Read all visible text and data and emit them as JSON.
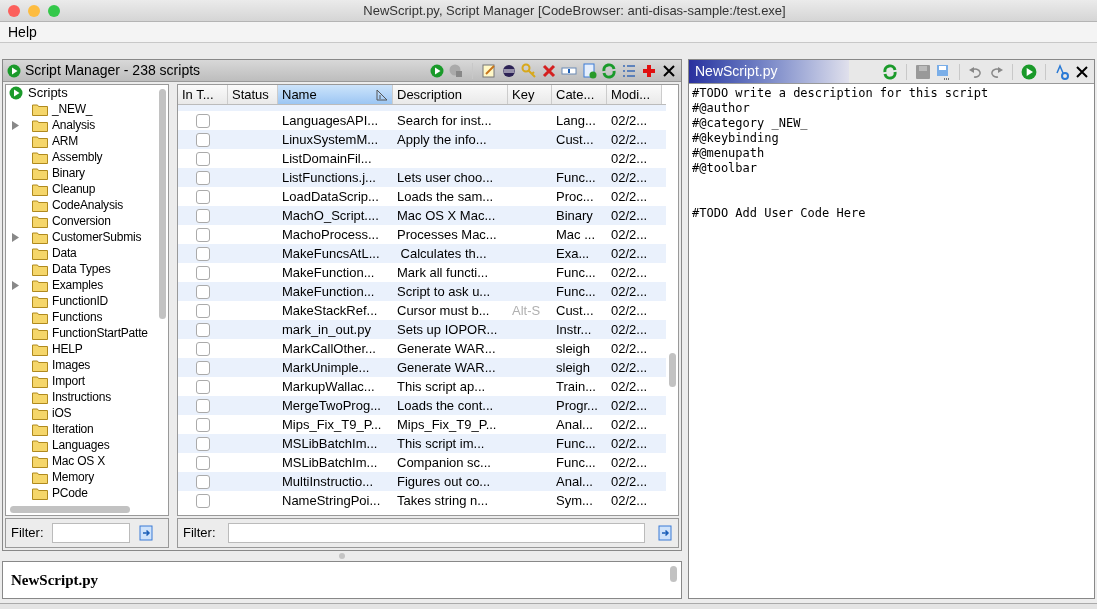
{
  "window": {
    "title": "NewScript.py, Script Manager [CodeBrowser: anti-disas-sample:/test.exe]"
  },
  "menu": [
    "Help"
  ],
  "script_manager": {
    "title": "Script Manager - 238 scripts",
    "tree": {
      "label": "Scripts",
      "children": [
        {
          "label": "_NEW_",
          "expandable": false
        },
        {
          "label": "Analysis",
          "expandable": true
        },
        {
          "label": "ARM",
          "expandable": false
        },
        {
          "label": "Assembly",
          "expandable": false
        },
        {
          "label": "Binary",
          "expandable": false
        },
        {
          "label": "Cleanup",
          "expandable": false
        },
        {
          "label": "CodeAnalysis",
          "expandable": false
        },
        {
          "label": "Conversion",
          "expandable": false
        },
        {
          "label": "CustomerSubmis",
          "expandable": true
        },
        {
          "label": "Data",
          "expandable": false
        },
        {
          "label": "Data Types",
          "expandable": false
        },
        {
          "label": "Examples",
          "expandable": true
        },
        {
          "label": "FunctionID",
          "expandable": false
        },
        {
          "label": "Functions",
          "expandable": false
        },
        {
          "label": "FunctionStartPatte",
          "expandable": false
        },
        {
          "label": "HELP",
          "expandable": false
        },
        {
          "label": "Images",
          "expandable": false
        },
        {
          "label": "Import",
          "expandable": false
        },
        {
          "label": "Instructions",
          "expandable": false
        },
        {
          "label": "iOS",
          "expandable": false
        },
        {
          "label": "Iteration",
          "expandable": false
        },
        {
          "label": "Languages",
          "expandable": false
        },
        {
          "label": "Mac OS X",
          "expandable": false
        },
        {
          "label": "Memory",
          "expandable": false
        },
        {
          "label": "PCode",
          "expandable": false
        }
      ]
    },
    "table": {
      "columns": [
        {
          "label": "In T...",
          "selected": false
        },
        {
          "label": "Status",
          "selected": false
        },
        {
          "label": "Name",
          "selected": true
        },
        {
          "label": "Description",
          "selected": false
        },
        {
          "label": "Key",
          "selected": false
        },
        {
          "label": "Cate...",
          "selected": false
        },
        {
          "label": "Modi...",
          "selected": false
        }
      ],
      "rows": [
        {
          "in_tool": false,
          "name": "LanguagesAPI...",
          "description": "Search for inst...",
          "key": "",
          "category": "Lang...",
          "modified": "02/2..."
        },
        {
          "in_tool": false,
          "name": "LinuxSystemM...",
          "description": "Apply the info...",
          "key": "",
          "category": "Cust...",
          "modified": "02/2..."
        },
        {
          "in_tool": false,
          "name": "ListDomainFil...",
          "description": "",
          "key": "",
          "category": "",
          "modified": "02/2..."
        },
        {
          "in_tool": false,
          "name": "ListFunctions.j...",
          "description": "Lets user choo...",
          "key": "",
          "category": "Func...",
          "modified": "02/2..."
        },
        {
          "in_tool": false,
          "name": "LoadDataScrip...",
          "description": "Loads the sam...",
          "key": "",
          "category": "Proc...",
          "modified": "02/2..."
        },
        {
          "in_tool": false,
          "name": "MachO_Script....",
          "description": "Mac OS X Mac...",
          "key": "",
          "category": "Binary",
          "modified": "02/2..."
        },
        {
          "in_tool": false,
          "name": "MachoProcess...",
          "description": "Processes Mac...",
          "key": "",
          "category": "Mac ...",
          "modified": "02/2..."
        },
        {
          "in_tool": false,
          "name": "MakeFuncsAtL...",
          "description": " Calculates th...",
          "key": "",
          "category": "Exa...",
          "modified": "02/2..."
        },
        {
          "in_tool": false,
          "name": "MakeFunction...",
          "description": "Mark all functi...",
          "key": "",
          "category": "Func...",
          "modified": "02/2..."
        },
        {
          "in_tool": false,
          "name": "MakeFunction...",
          "description": "Script to ask u...",
          "key": "",
          "category": "Func...",
          "modified": "02/2..."
        },
        {
          "in_tool": false,
          "name": "MakeStackRef...",
          "description": "Cursor must b...",
          "key": "Alt-S",
          "category": "Cust...",
          "modified": "02/2..."
        },
        {
          "in_tool": false,
          "name": "mark_in_out.py",
          "description": "Sets up IOPOR...",
          "key": "",
          "category": "Instr...",
          "modified": "02/2..."
        },
        {
          "in_tool": false,
          "name": "MarkCallOther...",
          "description": "Generate WAR...",
          "key": "",
          "category": "sleigh",
          "modified": "02/2..."
        },
        {
          "in_tool": false,
          "name": "MarkUnimple...",
          "description": "Generate WAR...",
          "key": "",
          "category": "sleigh",
          "modified": "02/2..."
        },
        {
          "in_tool": false,
          "name": "MarkupWallac...",
          "description": "This script ap...",
          "key": "",
          "category": "Train...",
          "modified": "02/2..."
        },
        {
          "in_tool": false,
          "name": "MergeTwoProg...",
          "description": "Loads the cont...",
          "key": "",
          "category": "Progr...",
          "modified": "02/2..."
        },
        {
          "in_tool": false,
          "name": "Mips_Fix_T9_P...",
          "description": "Mips_Fix_T9_P...",
          "key": "",
          "category": "Anal...",
          "modified": "02/2..."
        },
        {
          "in_tool": false,
          "name": "MSLibBatchIm...",
          "description": "This script im...",
          "key": "",
          "category": "Func...",
          "modified": "02/2..."
        },
        {
          "in_tool": false,
          "name": "MSLibBatchIm...",
          "description": "Companion sc...",
          "key": "",
          "category": "Func...",
          "modified": "02/2..."
        },
        {
          "in_tool": false,
          "name": "MultiInstructio...",
          "description": "Figures out co...",
          "key": "",
          "category": "Anal...",
          "modified": "02/2..."
        },
        {
          "in_tool": false,
          "name": "NameStringPoi...",
          "description": "Takes string n...",
          "key": "",
          "category": "Sym...",
          "modified": "02/2..."
        }
      ]
    },
    "tree_filter": {
      "label": "Filter:"
    },
    "table_filter": {
      "label": "Filter:"
    },
    "description_pane": {
      "text": "NewScript.py"
    }
  },
  "editor": {
    "title": "NewScript.py",
    "blocks": [
      [
        "#TODO write a description for this script",
        "#@author",
        "#@category _NEW_",
        "#@keybinding",
        "#@menupath",
        "#@toolbar"
      ],
      [
        "#TODO Add User Code Here"
      ]
    ]
  }
}
